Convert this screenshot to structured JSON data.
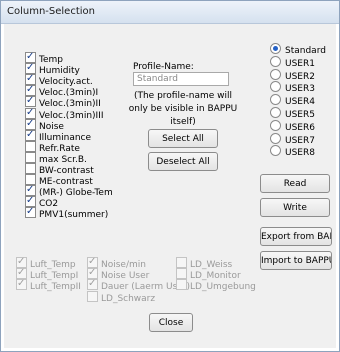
{
  "window": {
    "title": "Column-Selection"
  },
  "columns": [
    {
      "label": "Temp",
      "checked": true
    },
    {
      "label": "Humidity",
      "checked": true
    },
    {
      "label": "Velocity.act.",
      "checked": true
    },
    {
      "label": "Veloc.(3min)I",
      "checked": true
    },
    {
      "label": "Veloc.(3min)II",
      "checked": true
    },
    {
      "label": "Veloc.(3min)III",
      "checked": true
    },
    {
      "label": "Noise",
      "checked": true
    },
    {
      "label": "Illuminance",
      "checked": true
    },
    {
      "label": "Refr.Rate",
      "checked": false
    },
    {
      "label": "max Scr.B.",
      "checked": false
    },
    {
      "label": "BW-contrast",
      "checked": false
    },
    {
      "label": "ME-contrast",
      "checked": false
    },
    {
      "label": "(MR-) Globe-Tem",
      "checked": true
    },
    {
      "label": "CO2",
      "checked": true
    },
    {
      "label": "PMV1(summer)",
      "checked": true
    }
  ],
  "disabled_columns": {
    "col1": [
      {
        "label": "Luft_Temp",
        "checked": true
      },
      {
        "label": "Luft_TempI",
        "checked": true
      },
      {
        "label": "Luft_TempII",
        "checked": true
      }
    ],
    "col2": [
      {
        "label": "Noise/min",
        "checked": true
      },
      {
        "label": "Noise User",
        "checked": true
      },
      {
        "label": "Dauer (Laerm User)",
        "checked": true
      },
      {
        "label": "LD_Schwarz",
        "checked": false
      }
    ],
    "col3": [
      {
        "label": "LD_Weiss",
        "checked": false
      },
      {
        "label": "LD_Monitor",
        "checked": false
      },
      {
        "label": "LD_Umgebung",
        "checked": false
      }
    ]
  },
  "profile": {
    "name_label": "Profile-Name:",
    "name_value": "Standard",
    "note": "(The profile-name will only be visible in BAPPU itself)"
  },
  "buttons": {
    "select_all": "Select All",
    "deselect_all": "Deselect All",
    "read": "Read",
    "write": "Write",
    "export": "Export from BAPPU",
    "import": "Import to BAPPU",
    "close": "Close"
  },
  "profiles": [
    {
      "label": "Standard",
      "selected": true
    },
    {
      "label": "USER1",
      "selected": false
    },
    {
      "label": "USER2",
      "selected": false
    },
    {
      "label": "USER3",
      "selected": false
    },
    {
      "label": "USER4",
      "selected": false
    },
    {
      "label": "USER5",
      "selected": false
    },
    {
      "label": "USER6",
      "selected": false
    },
    {
      "label": "USER7",
      "selected": false
    },
    {
      "label": "USER8",
      "selected": false
    }
  ]
}
